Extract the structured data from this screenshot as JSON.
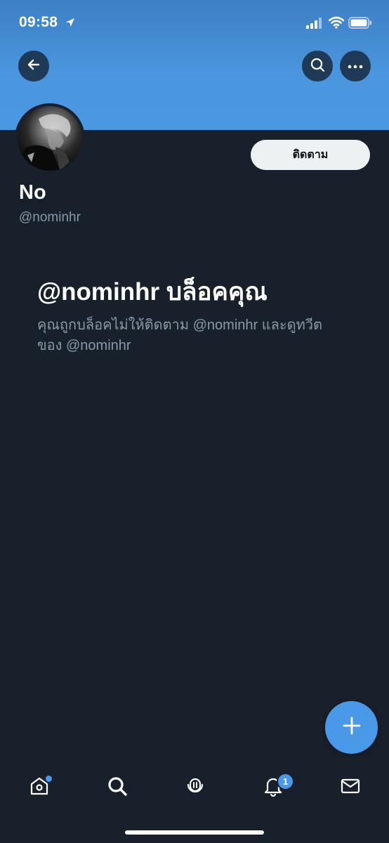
{
  "status_bar": {
    "time": "09:58",
    "icons": [
      "location-arrow-icon",
      "signal-icon",
      "wifi-icon",
      "battery-icon"
    ]
  },
  "header": {
    "back_icon": "arrow-left-icon",
    "search_icon": "search-icon",
    "more_icon": "more-horizontal-icon",
    "banner_color": "#4a95de"
  },
  "profile": {
    "display_name": "No",
    "handle": "@nominhr",
    "follow_label": "ติดตาม"
  },
  "blocked": {
    "title": "@nominhr บล็อคคุณ",
    "description": "คุณถูกบล็อคไม่ให้ติดตาม @nominhr และดูทวีตของ @nominhr"
  },
  "fab": {
    "icon": "plus-icon",
    "color": "#4a99e9"
  },
  "tabbar": {
    "items": [
      {
        "name": "home",
        "icon": "home-icon",
        "has_dot": true
      },
      {
        "name": "search",
        "icon": "search-icon"
      },
      {
        "name": "spaces",
        "icon": "spaces-icon"
      },
      {
        "name": "notifications",
        "icon": "bell-icon",
        "badge": "1"
      },
      {
        "name": "messages",
        "icon": "mail-icon"
      }
    ]
  },
  "colors": {
    "background": "#18202c",
    "accent": "#4a99e9",
    "secondary_text": "#8899a6"
  }
}
